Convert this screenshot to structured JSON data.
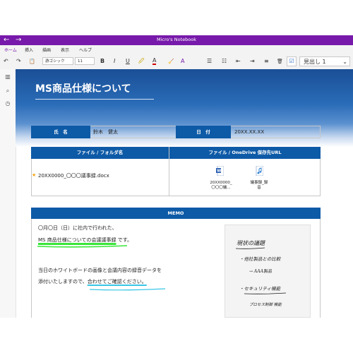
{
  "window": {
    "title": "Micro's Notebook",
    "nav_back": "←",
    "nav_forward": "→"
  },
  "menu_tabs": [
    "ホーム",
    "挿入",
    "描画",
    "表示",
    "ヘルプ"
  ],
  "ribbon": {
    "undo": "↶",
    "redo": "↷",
    "paste": "📋",
    "font_name": "游ゴシック",
    "font_size": "11",
    "bold": "B",
    "italic": "I",
    "underline": "U",
    "highlight": "🖉",
    "font_color": "A",
    "clear_format": "🧹",
    "text_effects": "A",
    "bullets": "☰",
    "numbering": "☷",
    "decrease_indent": "⇤",
    "increase_indent": "⇥",
    "align": "≡",
    "delete": "🗑",
    "more": "⌄",
    "todo_tag": "☑",
    "style": "見出し 1",
    "style_chevron": "⌄"
  },
  "leftbar": {
    "notebooks_icon": "▥",
    "search_icon": "⌕",
    "recent_icon": "◷"
  },
  "page": {
    "title": "MS商品仕様について"
  },
  "info_table": {
    "name_label": "氏　名",
    "name_value": "鈴木　健太",
    "date_label": "日　付",
    "date_value": "20XX.XX.XX"
  },
  "files_table": {
    "col1_header": "ファイル / フォルダ名",
    "col2_header": "ファイル / OneDrive 保存先URL",
    "file_name": "20XX0000_〇〇〇議事録.docx",
    "star": "★",
    "attachment1_line1": "20XX0000_",
    "attachment1_line2": "〇〇〇議...",
    "attachment2_line1": "議事録_録",
    "attachment2_line2": "音"
  },
  "memo": {
    "header": "MEMO",
    "line1": "〇月〇日（日）に社内で行われた、",
    "line2_highlight": "MS 商品仕様についての会議議事録",
    "line2_suffix": "です。",
    "line3": "当日のホワイトボードの画像と会議内容の録音データを",
    "line4_prefix": "添付いたしますので、",
    "line4_underlined": "合わせてご確認ください。",
    "handwriting": {
      "heading": "現状の議題",
      "item1": "・他社製品との比較",
      "item1_sub": "→ AAA製品",
      "item2": "・セキュリティ機能",
      "item3": "プロセス制御 機能"
    }
  },
  "colors": {
    "title_bar": "#7719aa",
    "table_header": "#0d5aa7",
    "highlight_green": "#39e639",
    "underline_cyan": "#39c6e6",
    "star": "#f2a516"
  }
}
